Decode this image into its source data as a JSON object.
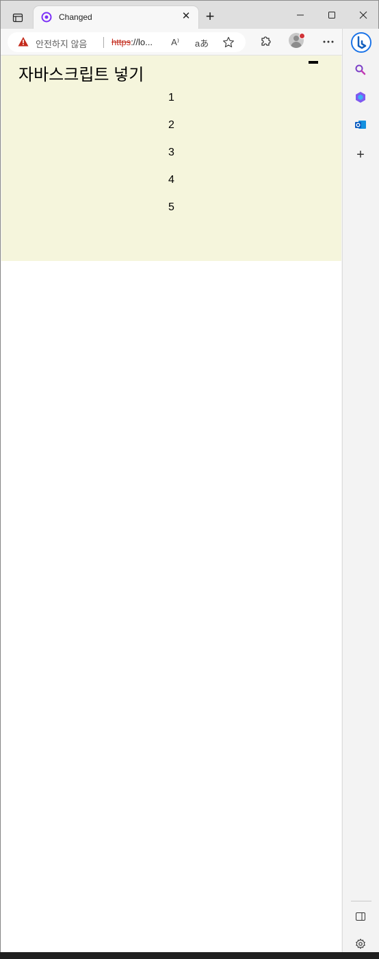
{
  "browser": {
    "tab": {
      "title": "Changed"
    },
    "address_bar": {
      "security_text": "안전하지 않음",
      "url_protocol": "https",
      "url_rest": "://lo..."
    },
    "read_aloud_label": "A⁾",
    "translate_label": "aあ"
  },
  "page": {
    "heading": "자바스크립트 넣기",
    "items": [
      "1",
      "2",
      "3",
      "4",
      "5"
    ],
    "background": "#f5f5dc"
  },
  "colors": {
    "accent": "#7b2ff7",
    "warning": "#c42b1c"
  }
}
